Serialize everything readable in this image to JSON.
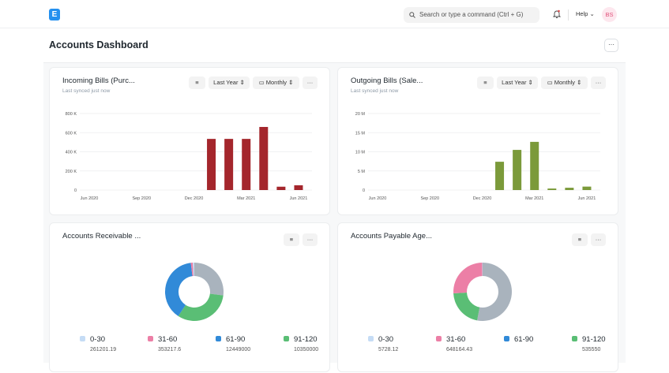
{
  "navbar": {
    "logo": "E",
    "search_placeholder": "Search or type a command (Ctrl + G)",
    "help": "Help",
    "avatar": "BS",
    "icons": [
      "search-icon",
      "bell-icon",
      "chevron-down-icon"
    ]
  },
  "page": {
    "title": "Accounts Dashboard",
    "menu": "···"
  },
  "cards": [
    {
      "title": "Incoming Bills (Purc...",
      "subtitle": "Last synced just now",
      "filter": "Last Year",
      "interval": "Monthly",
      "menu": "···"
    },
    {
      "title": "Outgoing Bills (Sale...",
      "subtitle": "Last synced just now",
      "filter": "Last Year",
      "interval": "Monthly",
      "menu": "···"
    },
    {
      "title": "Accounts Receivable ...",
      "menu": "···"
    },
    {
      "title": "Accounts Payable Age...",
      "menu": "···"
    }
  ],
  "chart_data": [
    {
      "type": "bar",
      "color": "#a4262c",
      "ylim": [
        0,
        800000
      ],
      "yticks": [
        "0",
        "200 K",
        "400 K",
        "600 K",
        "800 K"
      ],
      "ytick_values": [
        0,
        200000,
        400000,
        600000,
        800000
      ],
      "months": [
        "Jun 2020",
        "Jul 2020",
        "Aug 2020",
        "Sep 2020",
        "Oct 2020",
        "Nov 2020",
        "Dec 2020",
        "Jan 2021",
        "Feb 2021",
        "Mar 2021",
        "Apr 2021",
        "May 2021",
        "Jun 2021"
      ],
      "xtick_labels": [
        "Jun 2020",
        "Sep 2020",
        "Dec 2020",
        "Mar 2021",
        "Jun 2021"
      ],
      "values": [
        0,
        0,
        0,
        0,
        0,
        0,
        0,
        535000,
        535000,
        535000,
        660000,
        35000,
        50000
      ],
      "grid": true
    },
    {
      "type": "bar",
      "color": "#7b9a3a",
      "ylim": [
        0,
        20000000
      ],
      "yticks": [
        "0",
        "5 M",
        "10 M",
        "15 M",
        "20 M"
      ],
      "ytick_values": [
        0,
        5000000,
        10000000,
        15000000,
        20000000
      ],
      "months": [
        "Jun 2020",
        "Jul 2020",
        "Aug 2020",
        "Sep 2020",
        "Oct 2020",
        "Nov 2020",
        "Dec 2020",
        "Jan 2021",
        "Feb 2021",
        "Mar 2021",
        "Apr 2021",
        "May 2021",
        "Jun 2021"
      ],
      "xtick_labels": [
        "Jun 2020",
        "Sep 2020",
        "Dec 2020",
        "Mar 2021",
        "Jun 2021"
      ],
      "values": [
        0,
        0,
        0,
        0,
        0,
        0,
        0,
        7400000,
        10500000,
        12600000,
        400000,
        600000,
        900000
      ],
      "grid": true
    },
    {
      "type": "pie",
      "donut": true,
      "categories": [
        "0-30",
        "31-60",
        "61-90",
        "91-120"
      ],
      "value_labels": [
        "261201.19",
        "353217.6",
        "12449000",
        "10350000"
      ],
      "values": [
        261201.19,
        353217.6,
        12449000,
        10350000
      ],
      "colors": [
        "#c5dcf5",
        "#ec7fa6",
        "#318ad8",
        "#5abe75"
      ],
      "other_share_percent": 27,
      "other_color": "#a9b3bd"
    },
    {
      "type": "pie",
      "donut": true,
      "categories": [
        "0-30",
        "31-60",
        "61-90",
        "91-120"
      ],
      "value_labels": [
        "5728.12",
        "648164.43",
        "",
        ""
      ],
      "legend_values_right": "535550",
      "values": [
        5728.12,
        648164.43,
        0,
        535550
      ],
      "colors": [
        "#c5dcf5",
        "#ec7fa6",
        "#318ad8",
        "#5abe75"
      ],
      "other_share_percent": 53,
      "other_color": "#a9b3bd"
    }
  ]
}
